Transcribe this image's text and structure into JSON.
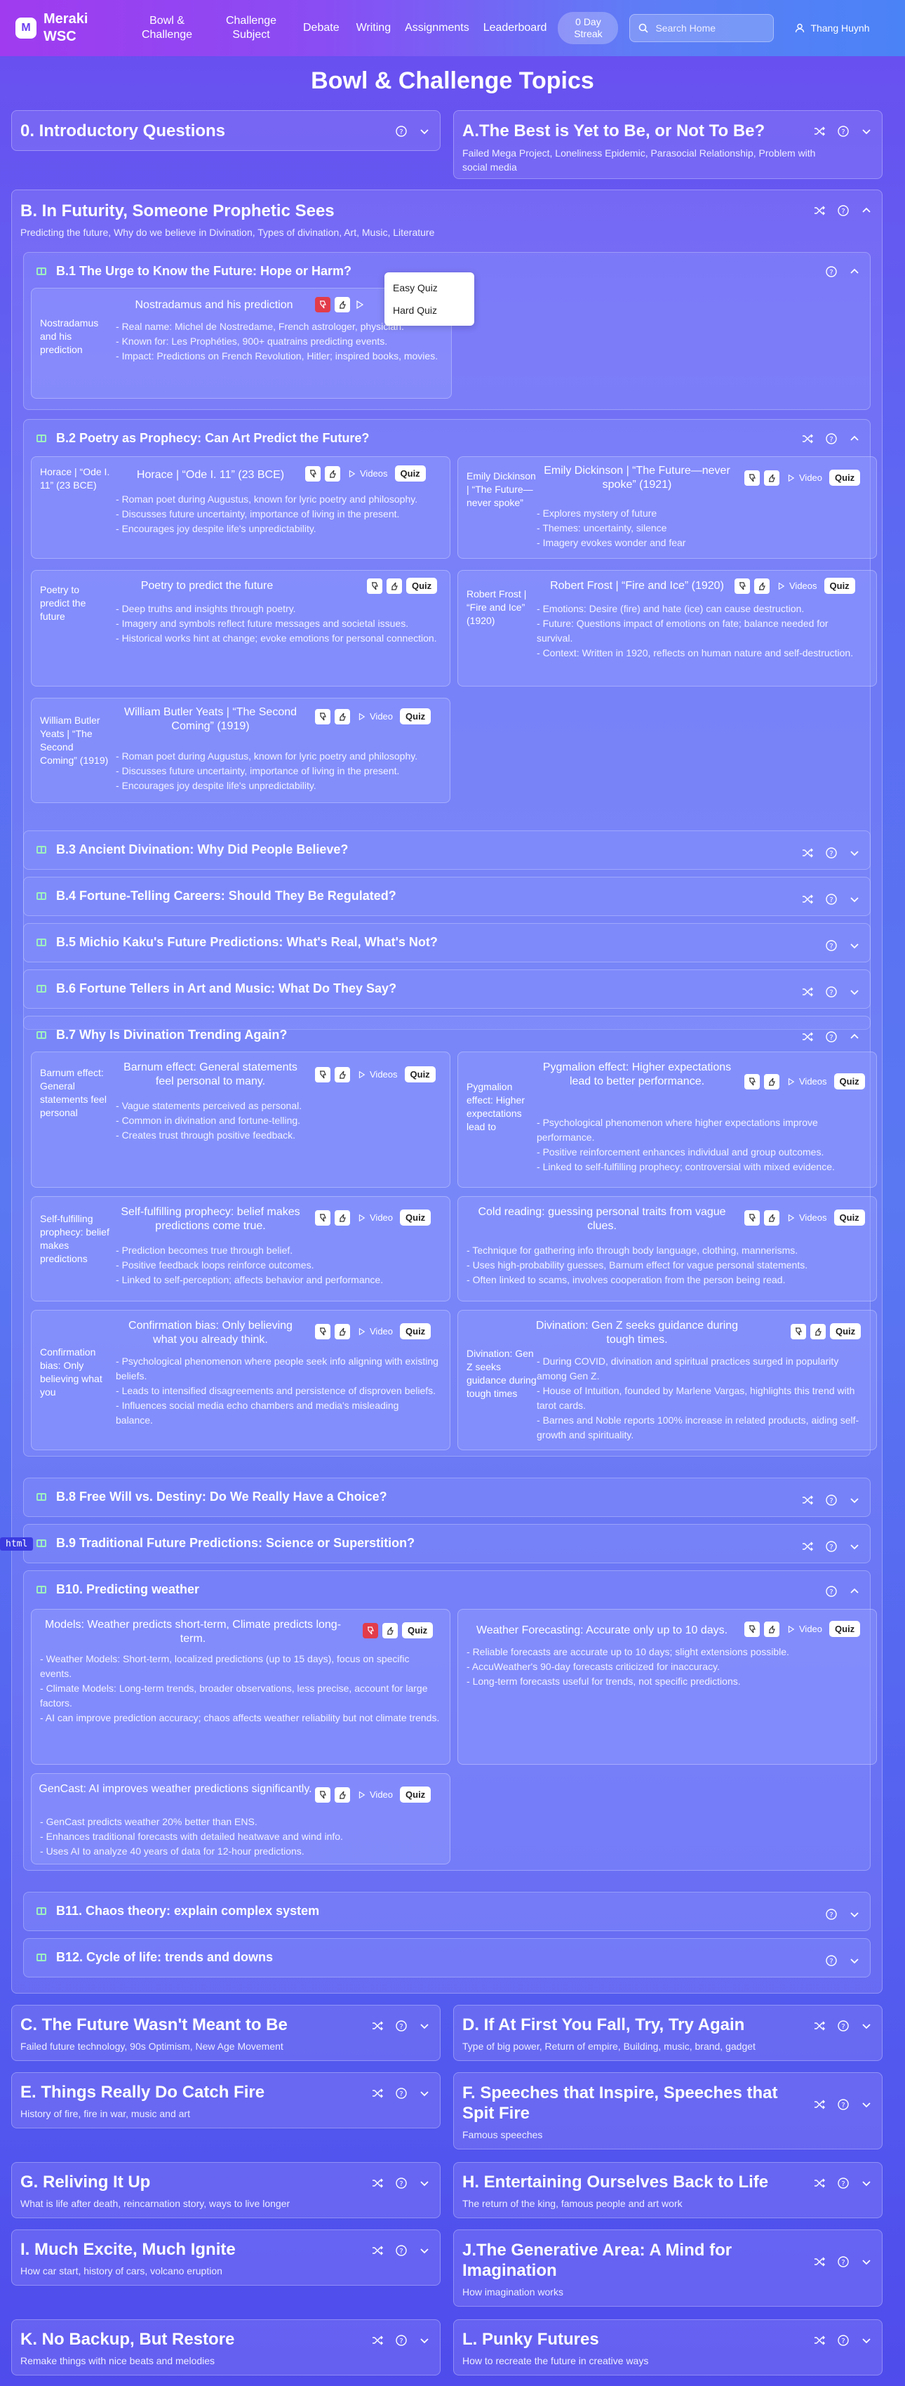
{
  "nav": {
    "logo": "M",
    "brand": "Meraki WSC",
    "links": [
      "Bowl & Challenge",
      "Challenge Subject",
      "Debate",
      "Writing",
      "Assignments",
      "Leaderboard"
    ],
    "streak": "0 Day Streak",
    "search_placeholder": "Search Home",
    "user": "Thang Huynh"
  },
  "page_title": "Bowl & Challenge Topics",
  "sections": {
    "s0": {
      "title": "0. Introductory Questions"
    },
    "sA": {
      "title": "A.The Best is Yet to Be, or Not To Be?",
      "desc": "Failed Mega Project, Loneliness Epidemic, Parasocial Relationship, Problem with social media"
    },
    "sB": {
      "title": "B. In Futurity, Someone Prophetic Sees",
      "desc": "Predicting the future, Why do we believe in Divination, Types of divination, Art, Music, Literature"
    },
    "sC": {
      "title": "C. The Future Wasn't Meant to Be",
      "desc": "Failed future technology, 90s Optimism, New Age Movement"
    },
    "sD": {
      "title": "D. If At First You Fall, Try, Try Again",
      "desc": "Type of big power, Return of empire, Building, music, brand, gadget"
    },
    "sE": {
      "title": "E. Things Really Do Catch Fire",
      "desc": "History of fire, fire in war, music and art"
    },
    "sF": {
      "title": "F. Speeches that Inspire, Speeches that Spit Fire",
      "desc": "Famous speeches"
    },
    "sG": {
      "title": "G. Reliving It Up",
      "desc": "What is life after death, reincarnation story, ways to live longer"
    },
    "sH": {
      "title": "H. Entertaining Ourselves Back to Life",
      "desc": "The return of the king, famous people and art work"
    },
    "sI": {
      "title": "I. Much Excite, Much Ignite",
      "desc": "How car start, history of cars, volcano eruption"
    },
    "sJ": {
      "title": "J.The Generative Area: A Mind for Imagination",
      "desc": "How imagination works"
    },
    "sK": {
      "title": "K. No Backup, But Restore",
      "desc": "Remake things with nice beats and melodies"
    },
    "sL": {
      "title": "L. Punky Futures",
      "desc": "How to recreate the future in creative ways"
    }
  },
  "subs": {
    "b1": "B.1 The Urge to Know the Future: Hope or Harm?",
    "b2": "B.2 Poetry as Prophecy: Can Art Predict the Future?",
    "b3": "B.3 Ancient Divination: Why Did People Believe?",
    "b4": "B.4 Fortune-Telling Careers: Should They Be Regulated?",
    "b5": "B.5 Michio Kaku's Future Predictions: What's Real, What's Not?",
    "b6": "B.6 Fortune Tellers in Art and Music: What Do They Say?",
    "b7": "B.7 Why Is Divination Trending Again?",
    "b8": "B.8 Free Will vs. Destiny: Do We Really Have a Choice?",
    "b9": "B.9 Traditional Future Predictions: Science or Superstition?",
    "b10": "B10. Predicting weather",
    "b11": "B11. Chaos theory: explain complex system",
    "b12": "B12. Cycle of life: trends and downs"
  },
  "dropdown": [
    "Easy Quiz",
    "Hard Quiz"
  ],
  "labels": {
    "video": "Video",
    "videos": "Videos",
    "quiz": "Quiz"
  },
  "items": {
    "nostra": {
      "title": "Nostradamus and his prediction",
      "alt": "Nostradamus and his prediction",
      "bullets": [
        "Real name: Michel de Nostredame, French astrologer, physician.",
        "Known for: Les Prophéties, 900+ quatrains predicting events.",
        "Impact: Predictions on French Revolution, Hitler; inspired books, movies."
      ]
    },
    "horace": {
      "title": "Horace | “Ode I. 11” (23 BCE)",
      "alt": "Horace | “Ode I. 11” (23 BCE)",
      "bullets": [
        "Roman poet during Augustus, known for lyric poetry and philosophy.",
        "Discusses future uncertainty, importance of living in the present.",
        "Encourages joy despite life's unpredictability."
      ]
    },
    "emily": {
      "title": "Emily Dickinson | “The Future—never spoke” (1921)",
      "alt": "Emily Dickinson | “The Future—never spoke”",
      "bullets": [
        "Explores mystery of future",
        "Themes: uncertainty, silence",
        "Imagery evokes wonder and fear"
      ]
    },
    "poetry": {
      "title": "Poetry to predict the future",
      "alt": "Poetry to predict the future",
      "bullets": [
        "Deep truths and insights through poetry.",
        "Imagery and symbols reflect future messages and societal issues.",
        "Historical works hint at change; evoke emotions for personal connection."
      ]
    },
    "frost": {
      "title": "Robert Frost | “Fire and Ice” (1920)",
      "alt": "Robert Frost | “Fire and Ice” (1920)",
      "bullets": [
        "Emotions: Desire (fire) and hate (ice) can cause destruction.",
        "Future: Questions impact of emotions on fate; balance needed for survival.",
        "Context: Written in 1920, reflects on human nature and self-destruction."
      ]
    },
    "yeats": {
      "title": "William Butler Yeats | “The Second Coming” (1919)",
      "alt": "William Butler Yeats | “The Second Coming” (1919)",
      "bullets": [
        "Roman poet during Augustus, known for lyric poetry and philosophy.",
        "Discusses future uncertainty, importance of living in the present.",
        "Encourages joy despite life's unpredictability."
      ]
    },
    "barnum": {
      "title": "Barnum effect: General statements feel personal to many.",
      "alt": "Barnum effect: General statements feel personal",
      "bullets": [
        "Vague statements perceived as personal.",
        "Common in divination and fortune-telling.",
        "Creates trust through positive feedback."
      ]
    },
    "pygmalion": {
      "title": "Pygmalion effect: Higher expectations lead to better performance.",
      "alt": "Pygmalion effect: Higher expectations lead to",
      "bullets": [
        "Psychological phenomenon where higher expectations improve performance.",
        "Positive reinforcement enhances individual and group outcomes.",
        "Linked to self-fulfilling prophecy; controversial with mixed evidence."
      ]
    },
    "selff": {
      "title": "Self-fulfilling prophecy: belief makes predictions come true.",
      "alt": "Self-fulfilling prophecy: belief makes predictions",
      "bullets": [
        "Prediction becomes true through belief.",
        "Positive feedback loops reinforce outcomes.",
        "Linked to self-perception; affects behavior and performance."
      ]
    },
    "cold": {
      "title": "Cold reading: guessing personal traits from vague clues.",
      "bullets": [
        "Technique for gathering info through body language, clothing, mannerisms.",
        "Uses high-probability guesses, Barnum effect for vague personal statements.",
        "Often linked to scams, involves cooperation from the person being read."
      ]
    },
    "confirm": {
      "title": "Confirmation bias: Only believing what you already think.",
      "alt": "Confirmation bias: Only believing what you",
      "bullets": [
        "Psychological phenomenon where people seek info aligning with existing beliefs.",
        "Leads to intensified disagreements and persistence of disproven beliefs.",
        "Influences social media echo chambers and media's misleading balance."
      ]
    },
    "genz": {
      "title": "Divination: Gen Z seeks guidance during tough times.",
      "alt": "Divination: Gen Z seeks guidance during tough times",
      "bullets": [
        "During COVID, divination and spiritual practices surged in popularity among Gen Z.",
        "House of Intuition, founded by Marlene Vargas, highlights this trend with tarot cards.",
        "Barnes and Noble reports 100% increase in related products, aiding self-growth and spirituality."
      ]
    },
    "models": {
      "title": "Models: Weather predicts short-term, Climate predicts long-term.",
      "bullets": [
        "Weather Models: Short-term, localized predictions (up to 15 days), focus on specific events.",
        "Climate Models: Long-term trends, broader observations, less precise, account for large factors.",
        "AI can improve prediction accuracy; chaos affects weather reliability but not climate trends."
      ]
    },
    "wforecast": {
      "title": "Weather Forecasting: Accurate only up to 10 days.",
      "bullets": [
        "Reliable forecasts are accurate up to 10 days; slight extensions possible.",
        "AccuWeather's 90-day forecasts criticized for inaccuracy.",
        "Long-term forecasts useful for trends, not specific predictions."
      ]
    },
    "gencast": {
      "title": "GenCast: AI improves weather predictions significantly.",
      "bullets": [
        "GenCast predicts weather 20% better than ENS.",
        "Enhances traditional forecasts with detailed heatwave and wind info.",
        "Uses AI to analyze 40 years of data for 12-hour predictions."
      ]
    }
  },
  "badge": "html",
  "colors": {
    "accent": "#6b3ef0",
    "quiz_bg": "#ffffff",
    "dislike_red": "#e23c4a",
    "book_green": "#9df0c0"
  }
}
